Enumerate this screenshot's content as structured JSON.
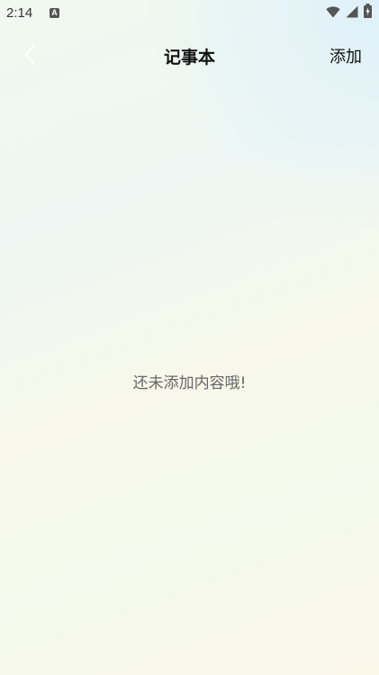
{
  "status_bar": {
    "time": "2:14",
    "notification_icon_letter": "A",
    "icons": [
      "wifi-icon",
      "signal-icon",
      "battery-icon"
    ]
  },
  "header": {
    "title": "记事本",
    "add_label": "添加"
  },
  "main": {
    "empty_message": "还未添加内容哦!"
  },
  "colors": {
    "title_text": "#111111",
    "empty_text": "#666666",
    "back_arrow": "#ffffff"
  }
}
